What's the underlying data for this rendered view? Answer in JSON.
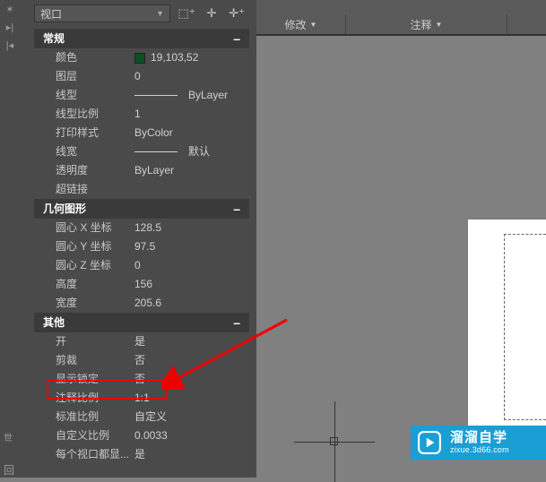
{
  "dropdown": {
    "label": "视口"
  },
  "ribbon": {
    "panel1": "修改",
    "panel2": "注释"
  },
  "sections": {
    "general": {
      "title": "常规",
      "color_label": "颜色",
      "color_value": "19,103,52",
      "layer_label": "图层",
      "layer_value": "0",
      "linetype_label": "线型",
      "linetype_value": "ByLayer",
      "ltscale_label": "线型比例",
      "ltscale_value": "1",
      "plotstyle_label": "打印样式",
      "plotstyle_value": "ByColor",
      "lineweight_label": "线宽",
      "lineweight_value": "默认",
      "transparency_label": "透明度",
      "transparency_value": "ByLayer",
      "hyperlink_label": "超链接",
      "hyperlink_value": ""
    },
    "geometry": {
      "title": "几何图形",
      "cx_label": "圆心 X 坐标",
      "cx_value": "128.5",
      "cy_label": "圆心 Y 坐标",
      "cy_value": "97.5",
      "cz_label": "圆心 Z 坐标",
      "cz_value": "0",
      "h_label": "高度",
      "h_value": "156",
      "w_label": "宽度",
      "w_value": "205.6"
    },
    "misc": {
      "title": "其他",
      "on_label": "开",
      "on_value": "是",
      "clip_label": "剪裁",
      "clip_value": "否",
      "lock_label": "显示锁定",
      "lock_value": "否",
      "annoscale_label": "注释比例",
      "annoscale_value": "1:1",
      "stdscale_label": "标准比例",
      "stdscale_value": "自定义",
      "custscale_label": "自定义比例",
      "custscale_value": "0.0033",
      "each_label": "每个视口都显...",
      "each_value": "是"
    }
  },
  "watermark": {
    "cn": "溜溜自学",
    "url": "zixue.3d66.com"
  }
}
